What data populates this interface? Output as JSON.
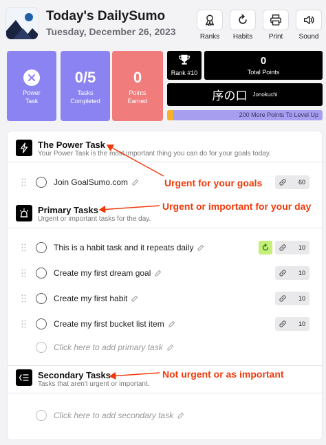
{
  "header": {
    "title": "Today's DailySumo",
    "date": "Tuesday, December 26, 2023",
    "buttons": [
      {
        "label": "Ranks",
        "icon": "ribbon-icon"
      },
      {
        "label": "Habits",
        "icon": "refresh-icon"
      },
      {
        "label": "Print",
        "icon": "printer-icon"
      },
      {
        "label": "Sound",
        "icon": "speaker-icon"
      }
    ]
  },
  "stats": {
    "power": {
      "label_line1": "Power",
      "label_line2": "Task"
    },
    "tasks": {
      "value": "0/5",
      "label_line1": "Tasks",
      "label_line2": "Completed"
    },
    "points": {
      "value": "0",
      "label_line1": "Points",
      "label_line2": "Earned"
    },
    "rank": {
      "label": "Rank #10"
    },
    "total_points": {
      "value": "0",
      "label": "Total Points"
    },
    "sumo_rank": {
      "kanji": "序の口",
      "romaji": "Jonokuchi"
    },
    "level": {
      "text": "200 More Points To Level Up",
      "progress": 0.04
    }
  },
  "sections": {
    "power": {
      "title": "The Power Task",
      "subtitle": "Your Power Task is the most important thing you can do for your goals today.",
      "tasks": [
        {
          "text": "Join GoalSumo.com",
          "points": "60"
        }
      ]
    },
    "primary": {
      "title": "Primary Tasks",
      "subtitle": "Urgent or important tasks for the day.",
      "tasks": [
        {
          "text": "This is a habit task and it repeats daily",
          "points": "10"
        },
        {
          "text": "Create my first dream goal",
          "points": "10"
        },
        {
          "text": "Create my first habit",
          "points": "10"
        },
        {
          "text": "Create my first bucket list item",
          "points": "10"
        }
      ],
      "add_placeholder": "Click here to add primary task"
    },
    "secondary": {
      "title": "Secondary Tasks",
      "subtitle": "Tasks that aren't urgent or important.",
      "add_placeholder": "Click here to add secondary task"
    }
  },
  "annotations": {
    "power": "Urgent for your goals",
    "primary": "Urgent or important for your day",
    "secondary": "Not urgent or as important"
  },
  "colors": {
    "purple_card": "#8b83f1",
    "red_card": "#f07c7c",
    "annotation": "#f0390a",
    "habit_green": "#c4f07a",
    "level_bar": "#a79ef0",
    "level_fill": "#f5b12a"
  }
}
